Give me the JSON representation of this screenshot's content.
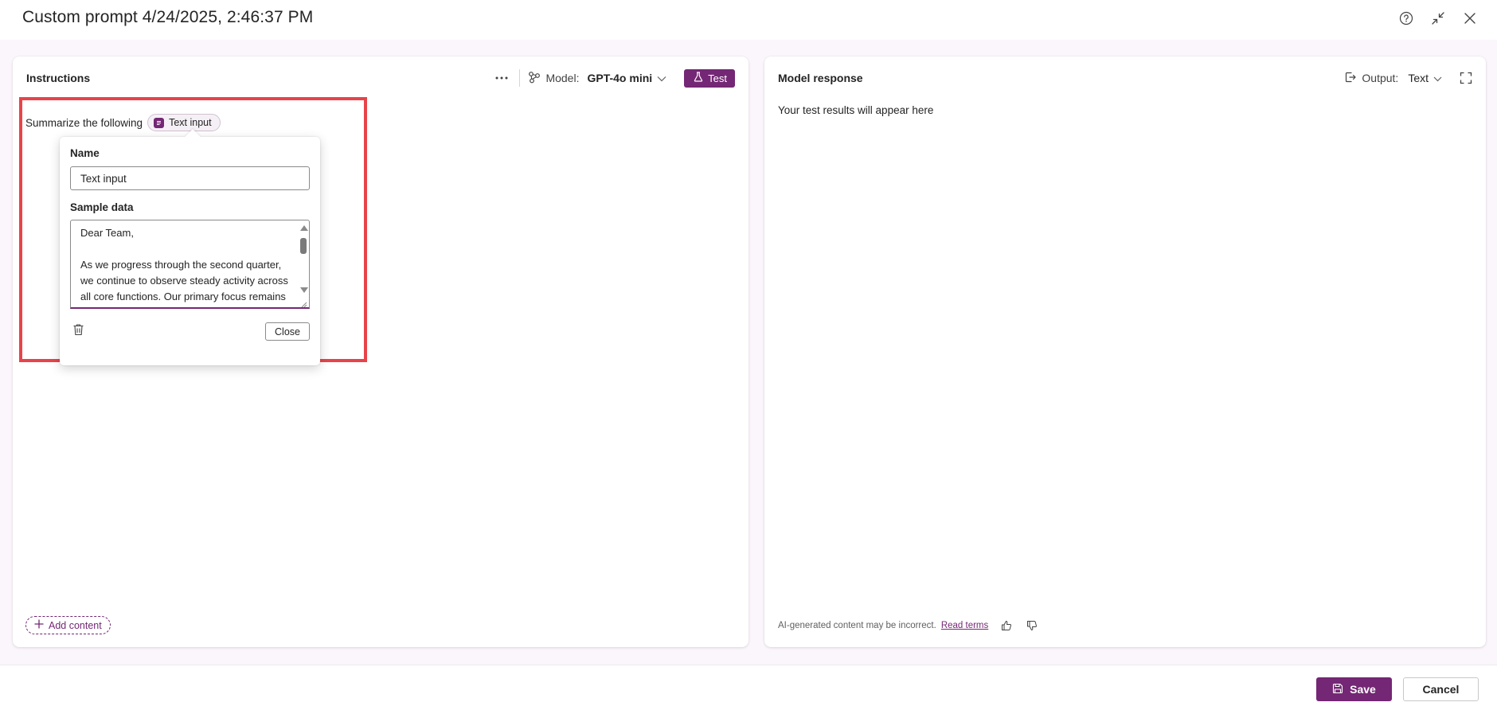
{
  "window": {
    "title": "Custom prompt 4/24/2025, 2:46:37 PM",
    "actions": [
      "help-icon",
      "collapse-icon",
      "close-icon"
    ]
  },
  "instructions": {
    "title": "Instructions",
    "model_label": "Model:",
    "model_value": "GPT-4o mini",
    "test_label": "Test",
    "prompt_text": "Summarize the following",
    "chip_label": "Text input",
    "add_content_label": "Add content"
  },
  "popover": {
    "name_label": "Name",
    "name_value": "Text input",
    "sample_label": "Sample data",
    "sample_value": "Dear Team,\n\nAs we progress through the second quarter, we continue to observe steady activity across all core functions. Our primary focus remains on streamlining",
    "close_label": "Close"
  },
  "response": {
    "title": "Model response",
    "output_label": "Output:",
    "output_value": "Text",
    "placeholder": "Your test results will appear here",
    "disclaimer": "AI-generated content may be incorrect.",
    "read_terms": "Read terms"
  },
  "footer": {
    "save_label": "Save",
    "cancel_label": "Cancel"
  },
  "colors": {
    "accent": "#742774",
    "highlight": "#e8434a",
    "workspace_bg": "#fbf6fb"
  }
}
